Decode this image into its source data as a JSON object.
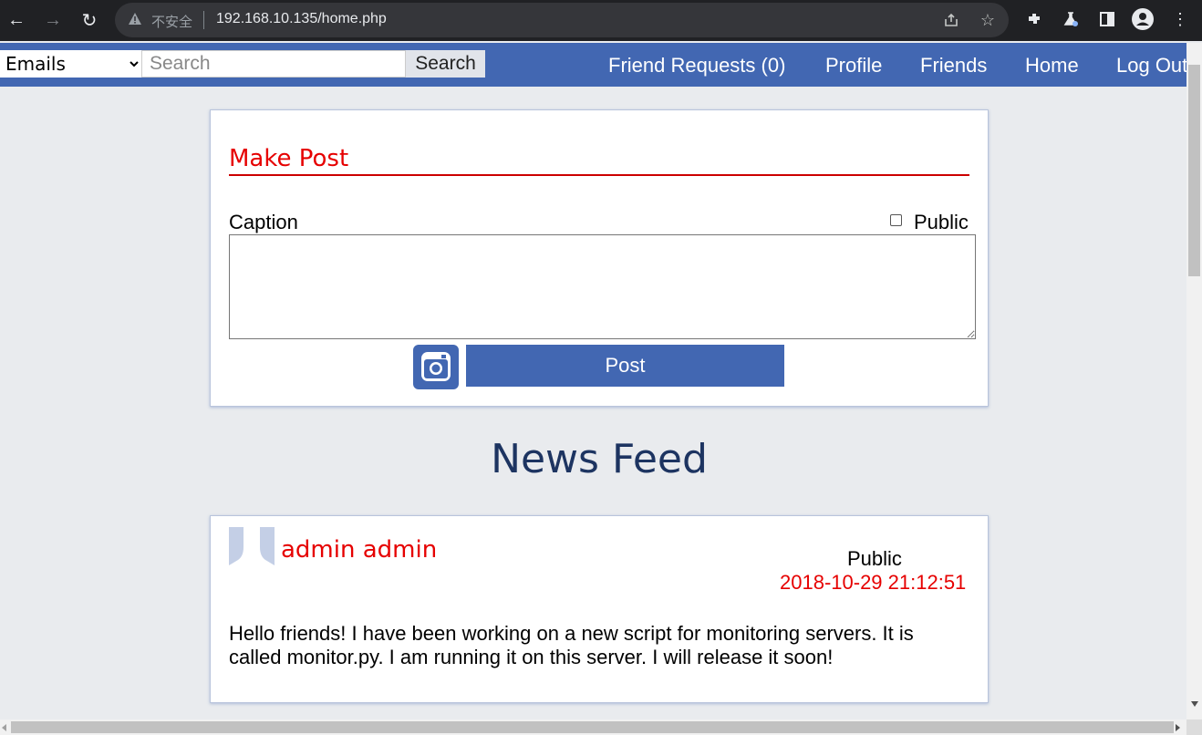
{
  "browser": {
    "security_label": "不安全",
    "url": "192.168.10.135/home.php"
  },
  "topbar": {
    "search_scope_options": [
      "Emails"
    ],
    "search_scope_selected": "Emails",
    "search_placeholder": "Search",
    "search_value": "",
    "search_button_label": "Search",
    "nav": {
      "friend_requests": "Friend Requests (0)",
      "profile": "Profile",
      "friends": "Friends",
      "home": "Home",
      "logout": "Log Out"
    },
    "color": "#4267b2"
  },
  "make_post": {
    "title": "Make Post",
    "caption_label": "Caption",
    "caption_value": "",
    "public_label": "Public",
    "public_checked": false,
    "photo_icon": "instagram-icon",
    "post_button_label": "Post"
  },
  "feed": {
    "title": "News Feed",
    "posts": [
      {
        "author": "admin admin",
        "visibility": "Public",
        "timestamp": "2018-10-29 21:12:51",
        "body": "Hello friends! I have been working on a new script for monitoring servers. It is called monitor.py. I am running it on this server. I will release it soon!"
      }
    ]
  },
  "colors": {
    "accent": "#4267b2",
    "highlight": "#e60000",
    "page_background": "#e9ebee"
  }
}
